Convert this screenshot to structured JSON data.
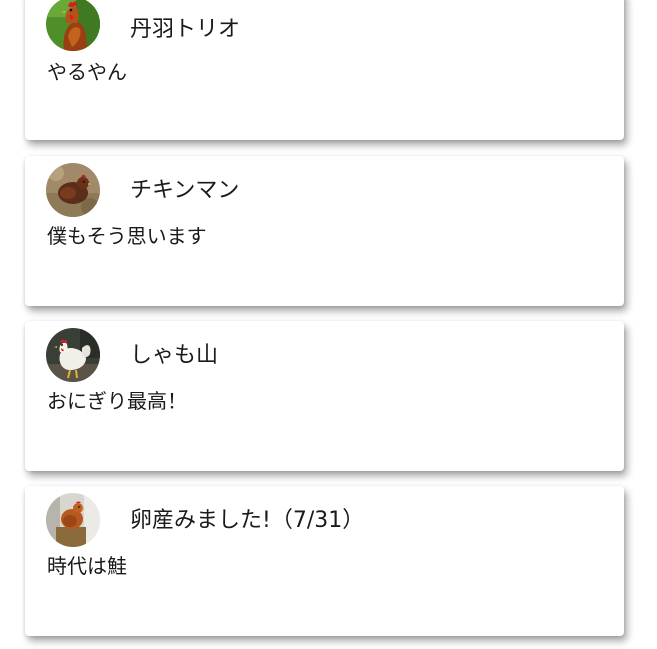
{
  "posts": [
    {
      "author": "丹羽トリオ",
      "message": "やるやん",
      "avatar_icon": "rooster-avatar-icon"
    },
    {
      "author": "チキンマン",
      "message": "僕もそう思います",
      "avatar_icon": "hen-avatar-icon"
    },
    {
      "author": "しゃも山",
      "message": "おにぎり最高！",
      "avatar_icon": "white-rooster-avatar-icon"
    },
    {
      "author": "卵産みました!（7/31）",
      "message": "時代は鮭",
      "avatar_icon": "brown-hen-avatar-icon"
    }
  ]
}
